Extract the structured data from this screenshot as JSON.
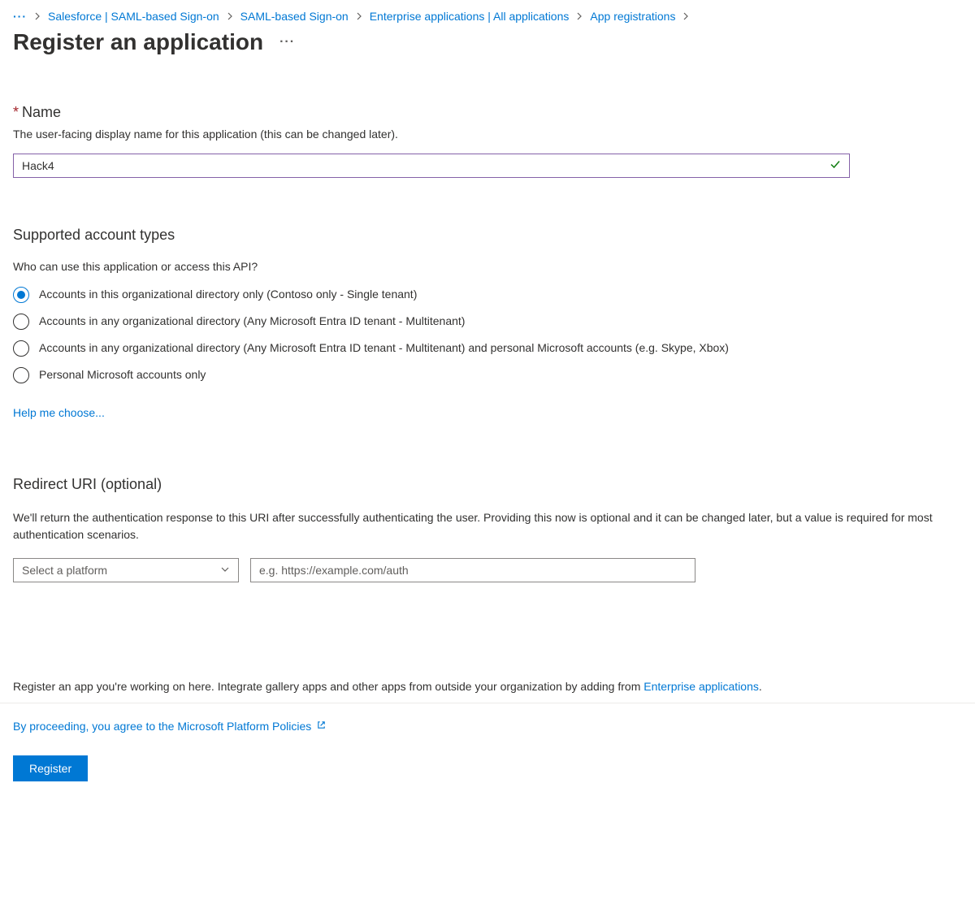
{
  "breadcrumb": {
    "items": [
      "Salesforce | SAML-based Sign-on",
      "SAML-based Sign-on",
      "Enterprise applications | All applications",
      "App registrations"
    ]
  },
  "page": {
    "title": "Register an application"
  },
  "nameField": {
    "label": "Name",
    "description": "The user-facing display name for this application (this can be changed later).",
    "value": "Hack4"
  },
  "supportedAccounts": {
    "heading": "Supported account types",
    "subheading": "Who can use this application or access this API?",
    "options": [
      "Accounts in this organizational directory only (Contoso only - Single tenant)",
      "Accounts in any organizational directory (Any Microsoft Entra ID tenant - Multitenant)",
      "Accounts in any organizational directory (Any Microsoft Entra ID tenant - Multitenant) and personal Microsoft accounts (e.g. Skype, Xbox)",
      "Personal Microsoft accounts only"
    ],
    "helpLink": "Help me choose..."
  },
  "redirectUri": {
    "heading": "Redirect URI (optional)",
    "description": "We'll return the authentication response to this URI after successfully authenticating the user. Providing this now is optional and it can be changed later, but a value is required for most authentication scenarios.",
    "platformPlaceholder": "Select a platform",
    "uriPlaceholder": "e.g. https://example.com/auth"
  },
  "footer": {
    "noteText": "Register an app you're working on here. Integrate gallery apps and other apps from outside your organization by adding from ",
    "noteLink": "Enterprise applications",
    "noteEnd": ".",
    "policyText": "By proceeding, you agree to the Microsoft Platform Policies",
    "registerLabel": "Register"
  }
}
